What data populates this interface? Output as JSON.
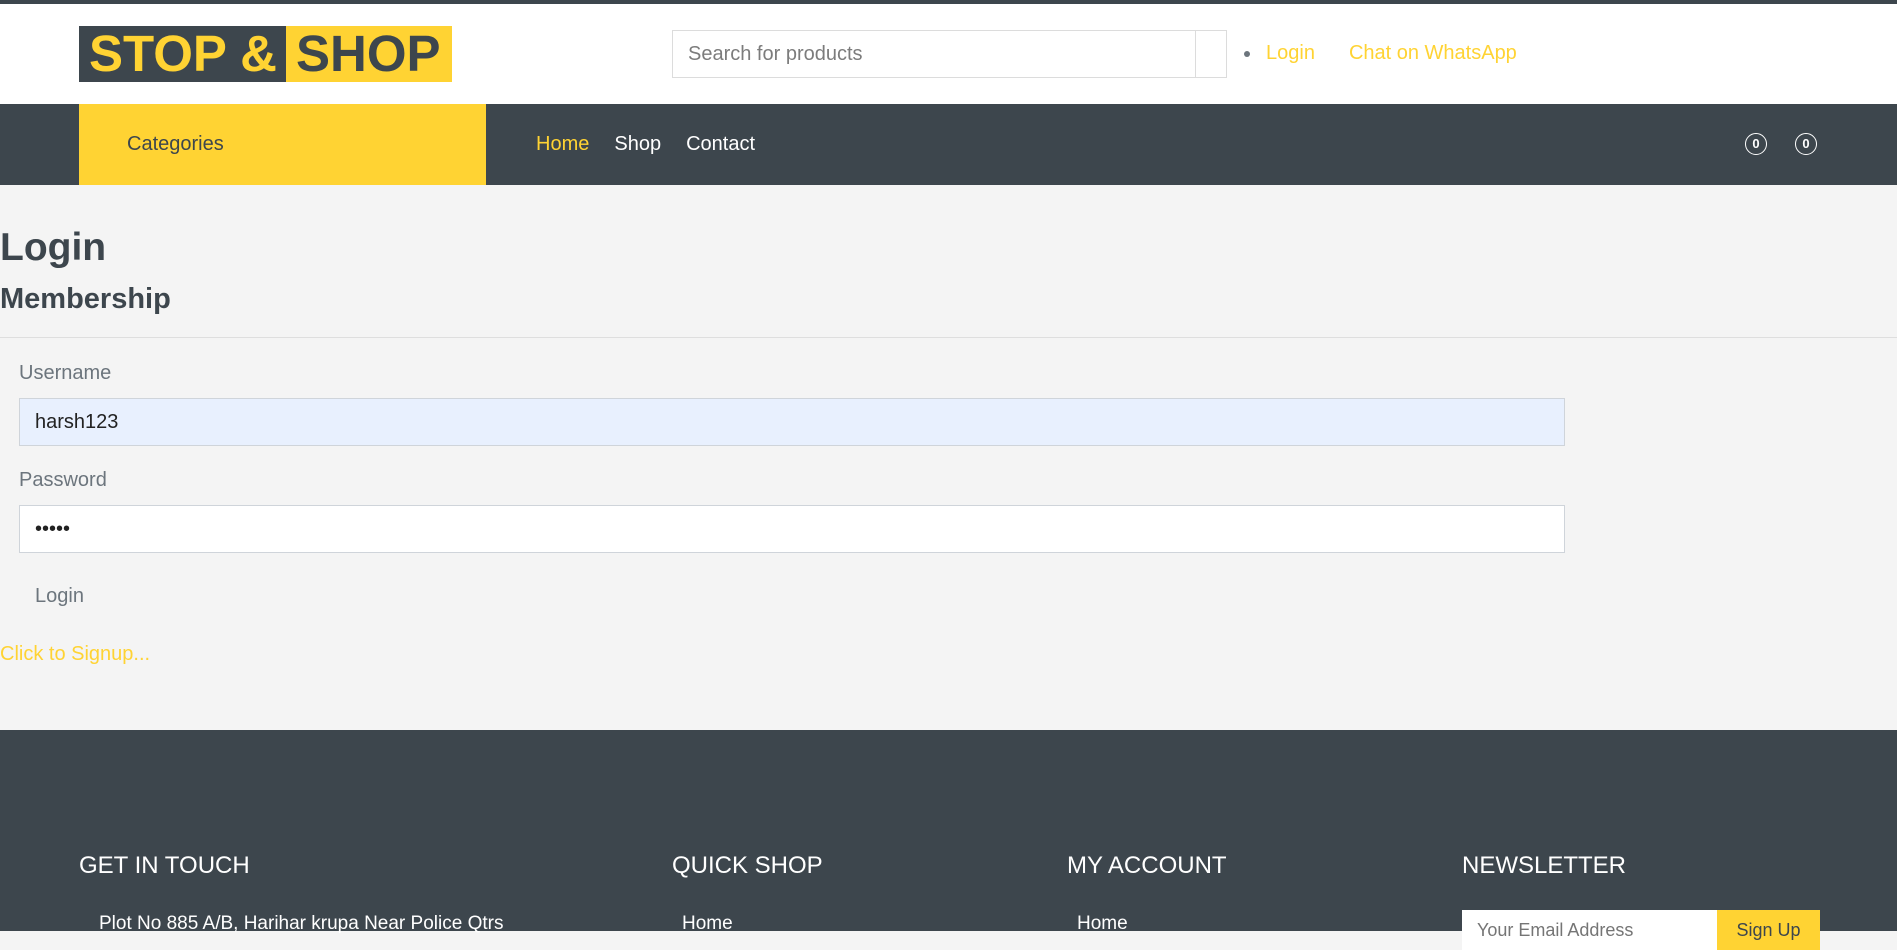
{
  "brand": {
    "part1": "STOP &",
    "part2": "SHOP"
  },
  "header": {
    "search_placeholder": "Search for products",
    "login_link": "Login",
    "whatsapp_link": "Chat on WhatsApp"
  },
  "nav": {
    "categories_label": "Categories",
    "links": [
      "Home",
      "Shop",
      "Contact"
    ],
    "active": "Home",
    "badge_1": "0",
    "badge_2": "0"
  },
  "page": {
    "title": "Login",
    "subtitle": "Membership"
  },
  "form": {
    "username_label": "Username",
    "username_value": "harsh123",
    "password_label": "Password",
    "password_value": "•••••",
    "login_button": "Login",
    "signup_link": "Click to Signup..."
  },
  "footer": {
    "get_in_touch": "GET IN TOUCH",
    "address": "Plot No 885 A/B, Harihar krupa Near Police Qtrs",
    "quick_shop": "QUICK SHOP",
    "quick_shop_first": "Home",
    "my_account": "MY ACCOUNT",
    "my_account_first": "Home",
    "newsletter": "NEWSLETTER",
    "newsletter_placeholder": "Your Email Address",
    "newsletter_button": "Sign Up"
  },
  "colors": {
    "accent": "#ffd333",
    "dark": "#3d464d",
    "background": "#f4f4f4",
    "autofill": "#e8f0fe"
  }
}
